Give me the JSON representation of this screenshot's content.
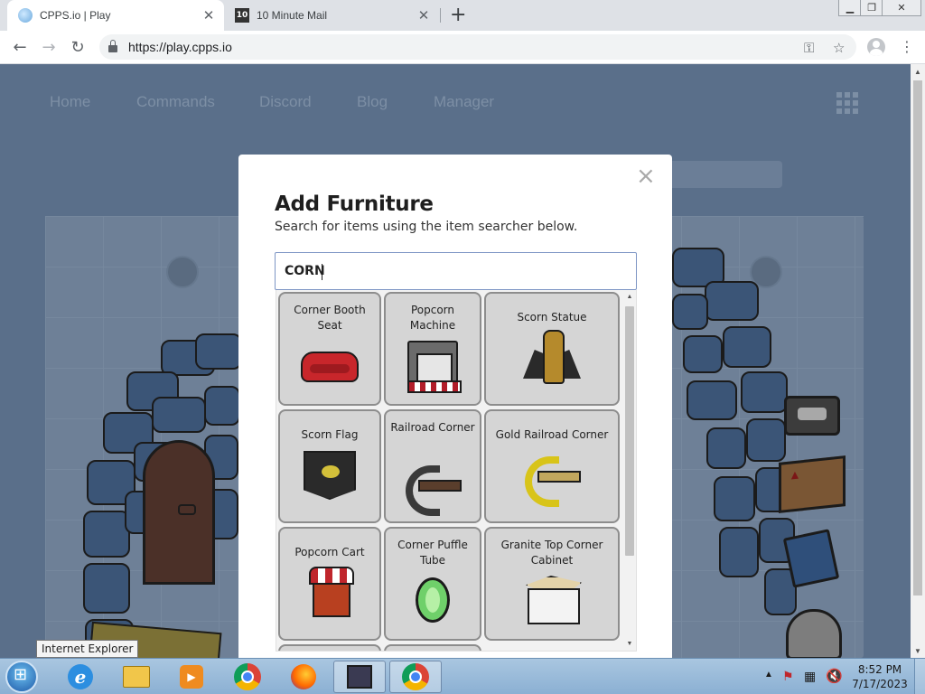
{
  "browser": {
    "tabs": [
      {
        "title": "CPPS.io | Play",
        "active": true
      },
      {
        "title": "10 Minute Mail",
        "active": false
      }
    ],
    "url": "https://play.cpps.io",
    "favicon_text_tab2": "10"
  },
  "site_nav": {
    "links": [
      "Home",
      "Commands",
      "Discord",
      "Blog",
      "Manager"
    ]
  },
  "modal": {
    "title": "Add Furniture",
    "subtitle": "Search for items using the item searcher below.",
    "search_value": "CORN",
    "close_glyph": "×",
    "items": [
      {
        "label": "Corner Booth Seat",
        "icon": "sofa-icon"
      },
      {
        "label": "Popcorn Machine",
        "icon": "popcorn-machine-icon"
      },
      {
        "label": "Scorn Statue",
        "icon": "statue-icon"
      },
      {
        "label": "Scorn Flag",
        "icon": "flag-icon"
      },
      {
        "label": "Railroad Corner",
        "icon": "railroad-icon"
      },
      {
        "label": "Gold Railroad Corner",
        "icon": "gold-railroad-icon"
      },
      {
        "label": "Popcorn Cart",
        "icon": "popcorn-cart-icon"
      },
      {
        "label": "Corner Puffle Tube",
        "icon": "puffle-tube-icon"
      },
      {
        "label": "Granite Top Corner Cabinet",
        "icon": "cabinet-icon"
      }
    ]
  },
  "taskbar": {
    "tooltip": "Internet Explorer",
    "time": "8:52 PM",
    "date": "7/17/2023"
  },
  "colors": {
    "page_background": "#5a6f8a",
    "modal_background": "#ffffff",
    "item_tile": "#d5d5d5",
    "search_border": "#7d95c4"
  }
}
